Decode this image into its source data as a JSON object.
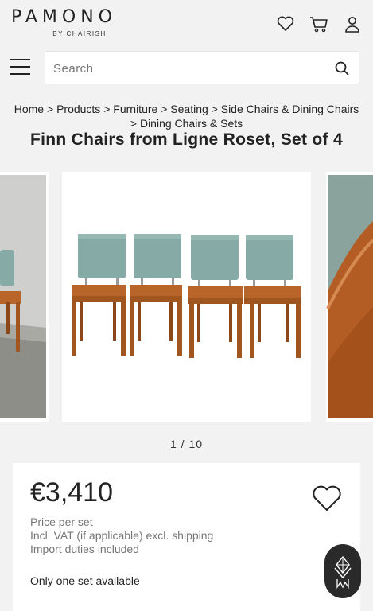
{
  "brand": {
    "name": "PAMONO",
    "sub": "BY CHAIRISH"
  },
  "header_icons": [
    "heart-icon",
    "cart-icon",
    "user-icon"
  ],
  "search": {
    "placeholder": "Search"
  },
  "breadcrumb": {
    "home": "Home",
    "products": "Products",
    "furniture": "Furniture",
    "seating": "Seating",
    "side_chairs": "Side Chairs & Dining Chairs",
    "dining_sets": "Dining Chairs & Sets",
    "separator": ">"
  },
  "product": {
    "title": "Finn Chairs from Ligne Roset, Set of 4",
    "image_counter": "1 / 10",
    "price": "€3,410",
    "price_note": "Price per set",
    "vat_note": "Incl. VAT (if applicable) excl. shipping",
    "duties_note": "Import duties included",
    "availability": "Only one set available"
  },
  "colors": {
    "background": "#f2f2f2",
    "seat_upholstery": "#86aba6",
    "wood": "#b9652a"
  }
}
